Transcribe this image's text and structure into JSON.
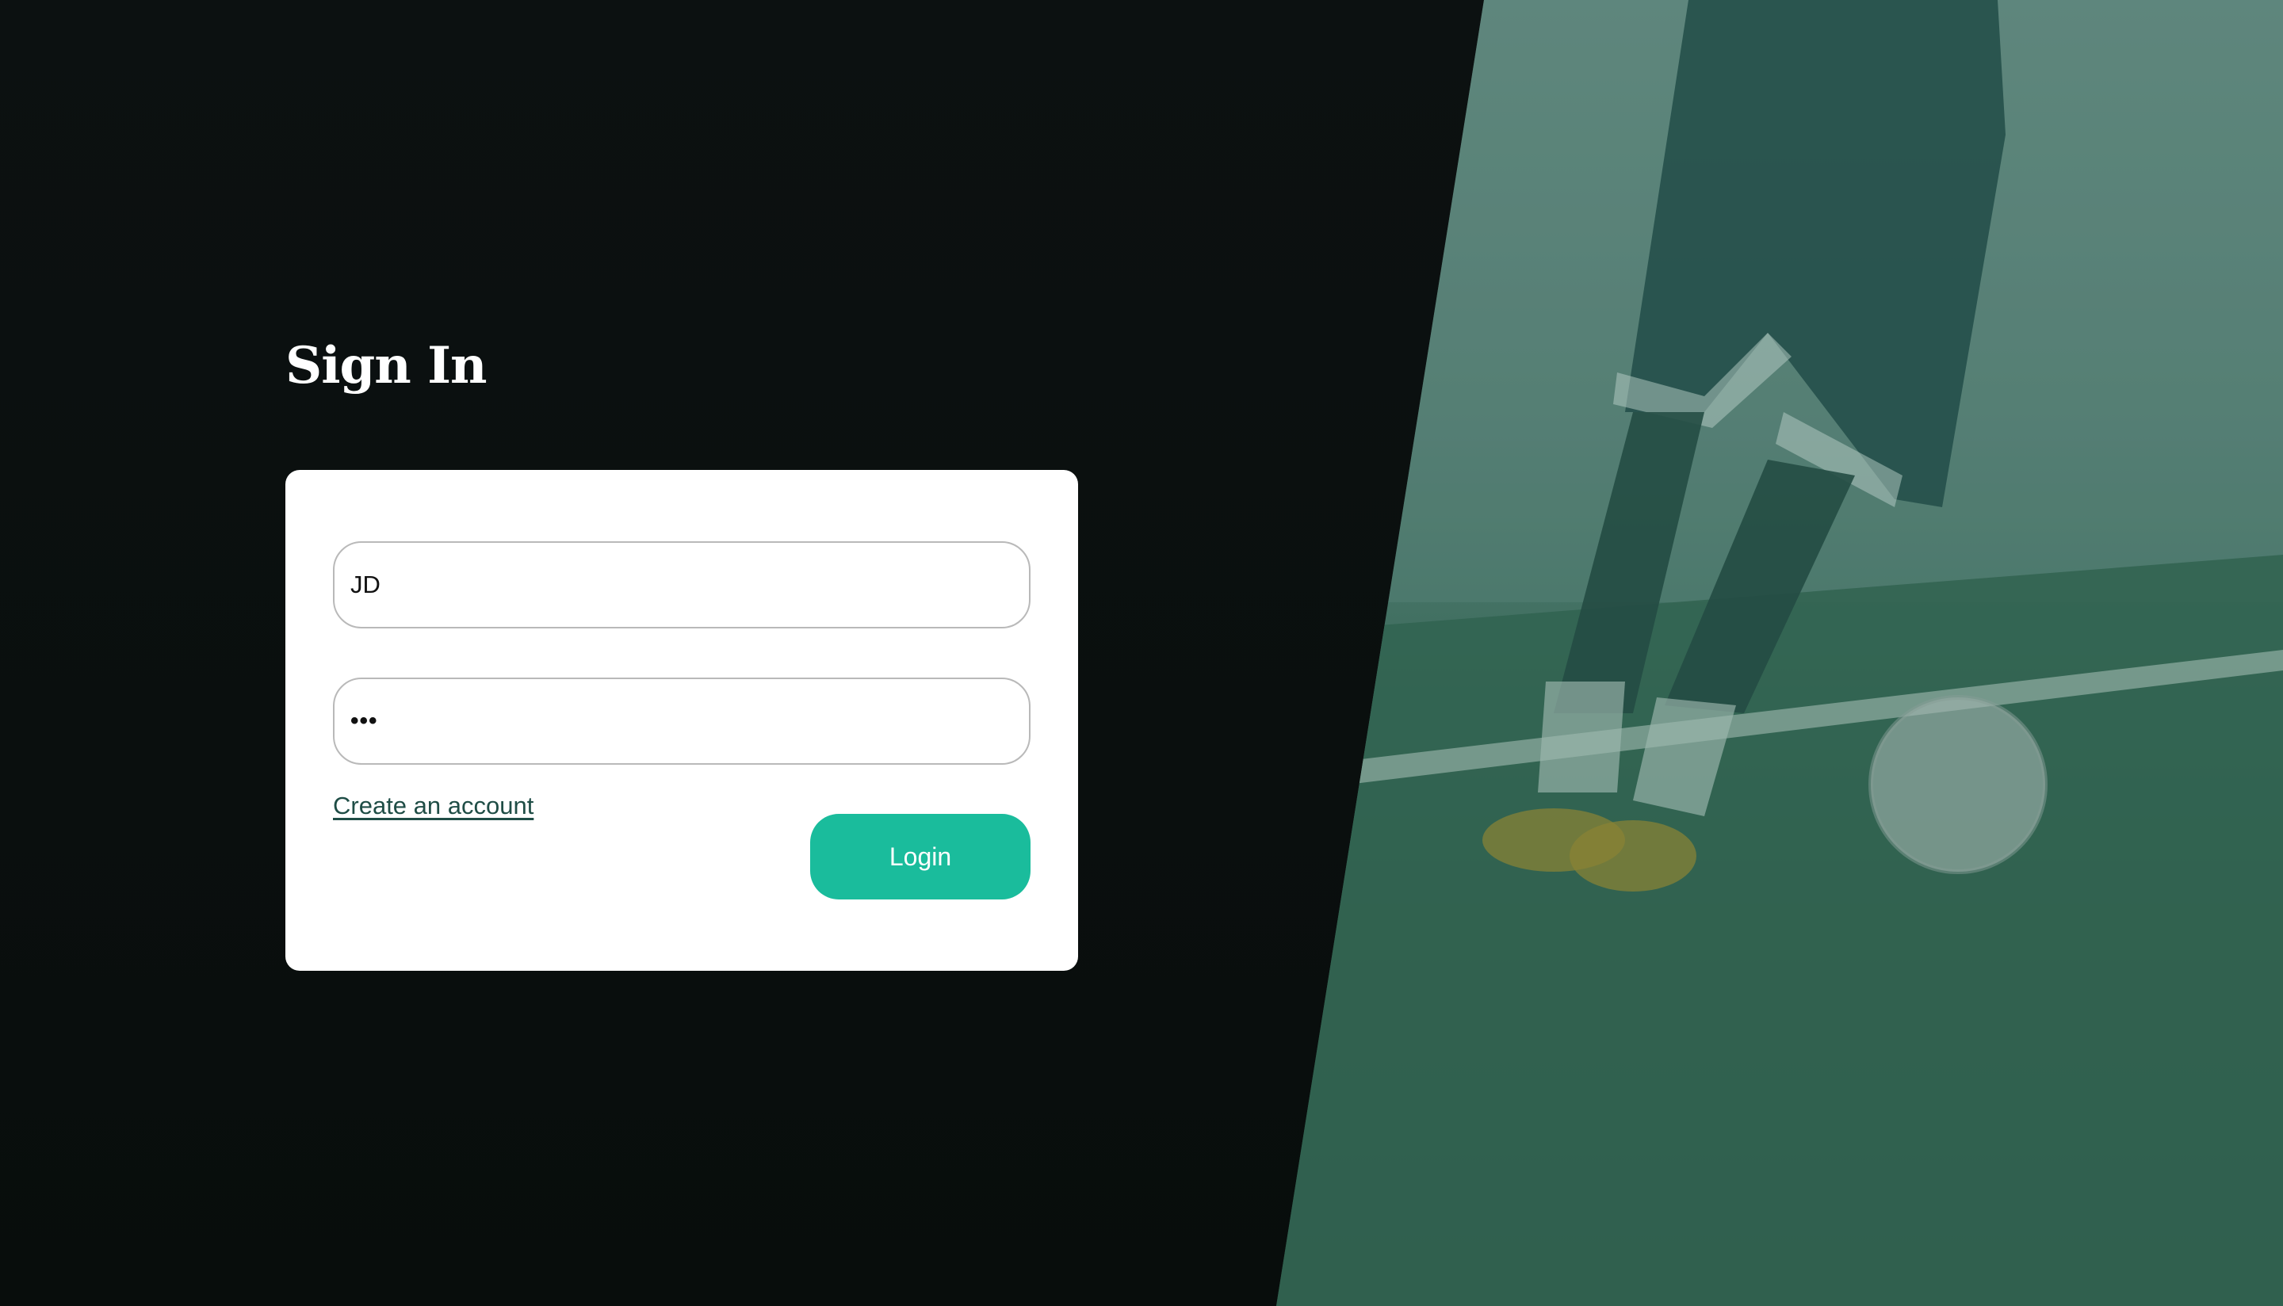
{
  "page": {
    "title": "Sign In"
  },
  "form": {
    "username_value": "JD",
    "password_masked": "•••",
    "create_account_label": "Create an account",
    "login_label": "Login"
  },
  "colors": {
    "background_dark": "#0b0f0e",
    "card": "#ffffff",
    "accent": "#1abc9c",
    "link": "#1f4d46",
    "photo_tint": "#4f7a6d"
  },
  "background_image": {
    "subject": "soccer-player-kicking-ball"
  }
}
